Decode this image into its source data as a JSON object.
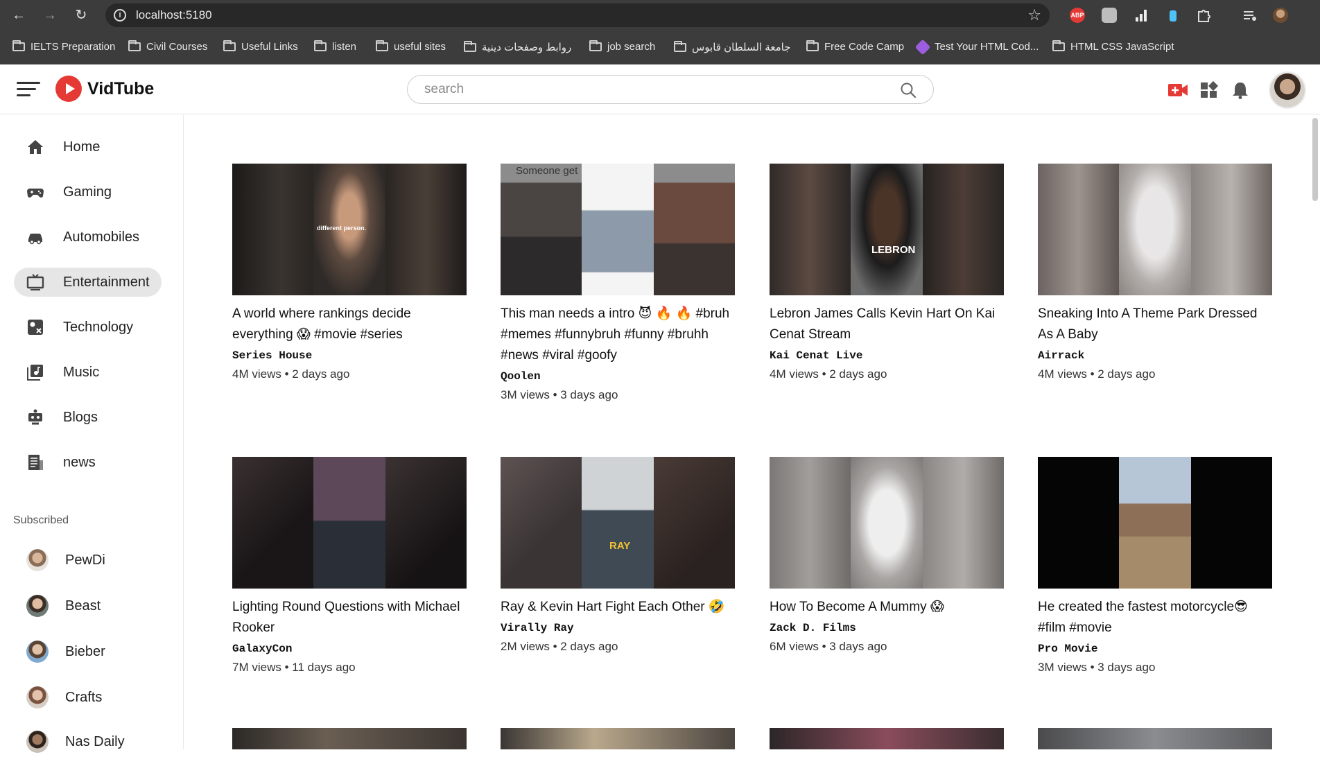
{
  "browser": {
    "url": "localhost:5180",
    "bookmarks": [
      "IELTS Preparation",
      "Civil Courses",
      "Useful Links",
      "listen",
      "useful sites",
      "روابط وصفحات دينية",
      "job search",
      "جامعة السلطان قابوس",
      "Free Code Camp",
      "Test Your HTML Cod...",
      "HTML CSS JavaScript"
    ],
    "extensions": [
      "abp-icon",
      "extension-icon",
      "signal-icon",
      "bottle-icon",
      "puzzle-icon",
      "media-icon",
      "profile-icon"
    ]
  },
  "header": {
    "logo_text": "VidTube",
    "search_placeholder": "search"
  },
  "sidebar": {
    "items": [
      {
        "label": "Home",
        "icon": "home-icon"
      },
      {
        "label": "Gaming",
        "icon": "gamepad-icon"
      },
      {
        "label": "Automobiles",
        "icon": "car-icon"
      },
      {
        "label": "Entertainment",
        "icon": "tv-icon",
        "active": true
      },
      {
        "label": "Technology",
        "icon": "technology-icon"
      },
      {
        "label": "Music",
        "icon": "music-icon"
      },
      {
        "label": "Blogs",
        "icon": "blogs-icon"
      },
      {
        "label": "news",
        "icon": "news-icon"
      }
    ],
    "subscribed_title": "Subscribed",
    "subscribed": [
      {
        "label": "PewDi"
      },
      {
        "label": "Beast"
      },
      {
        "label": "Bieber"
      },
      {
        "label": "Crafts"
      },
      {
        "label": "Nas Daily"
      }
    ]
  },
  "videos": [
    {
      "title": "A world where rankings decide everything 😱 #movie #series",
      "channel": "Series House",
      "meta": "4M views • 2 days ago",
      "thumb_text": "different person."
    },
    {
      "title": "This man needs a intro 😈 🔥 🔥 #bruh #memes #funnybruh #funny #bruhh #news #viral #goofy",
      "channel": "Qoolen",
      "meta": "3M views • 3 days ago",
      "thumb_text": "Someone get"
    },
    {
      "title": "Lebron James Calls Kevin Hart On Kai Cenat Stream",
      "channel": "Kai Cenat Live",
      "meta": "4M views • 2 days ago",
      "thumb_text": "LEBRON"
    },
    {
      "title": "Sneaking Into A Theme Park Dressed As A Baby",
      "channel": "Airrack",
      "meta": "4M views • 2 days ago",
      "thumb_text": ""
    },
    {
      "title": "Lighting Round Questions with Michael Rooker",
      "channel": "GalaxyCon",
      "meta": "7M views • 11 days ago",
      "thumb_text": ""
    },
    {
      "title": "Ray & Kevin Hart Fight Each Other 🤣",
      "channel": "Virally Ray",
      "meta": "2M views • 2 days ago",
      "thumb_text": "RAY"
    },
    {
      "title": "How To Become A Mummy 😱",
      "channel": "Zack D. Films",
      "meta": "6M views • 3 days ago",
      "thumb_text": ""
    },
    {
      "title": "He created the fastest motorcycle😎 #film #movie",
      "channel": "Pro Movie",
      "meta": "3M views • 3 days ago",
      "thumb_text": ""
    }
  ]
}
